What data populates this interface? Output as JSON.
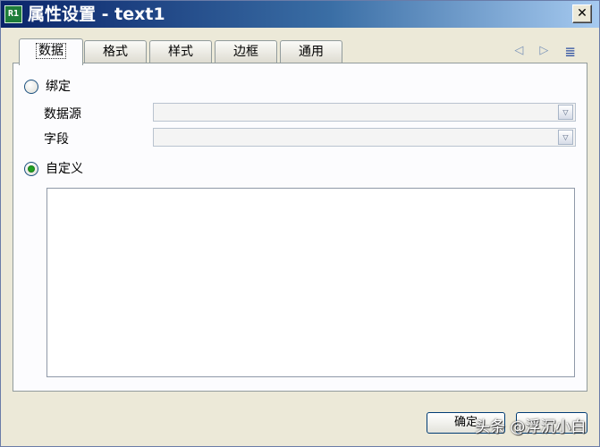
{
  "window": {
    "title": "属性设置 - text1",
    "app_icon_text": "R1",
    "close_glyph": "✕"
  },
  "tabs": [
    {
      "label": "数据",
      "active": true
    },
    {
      "label": "格式",
      "active": false
    },
    {
      "label": "样式",
      "active": false
    },
    {
      "label": "边框",
      "active": false
    },
    {
      "label": "通用",
      "active": false
    }
  ],
  "nav": {
    "prev_icon": "◁",
    "next_icon": "▷",
    "list_icon": "≣"
  },
  "bind_option": {
    "label": "绑定",
    "checked": false
  },
  "data_source": {
    "label": "数据源",
    "value": ""
  },
  "field": {
    "label": "字段",
    "value": ""
  },
  "custom_option": {
    "label": "自定义",
    "checked": true
  },
  "custom_text": "",
  "buttons": {
    "ok": "确定",
    "cancel": ""
  },
  "watermark": "头条 @浮沉小白",
  "dropdown_glyph": "▽"
}
